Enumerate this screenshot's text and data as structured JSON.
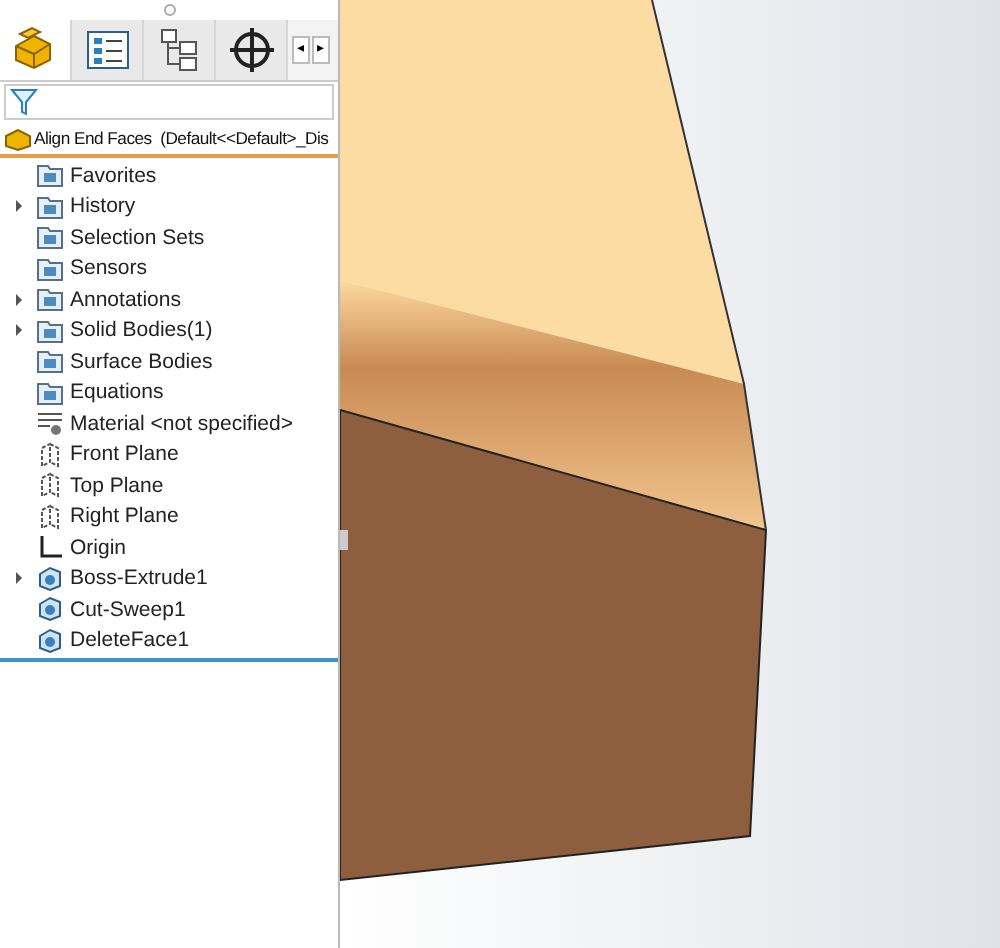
{
  "tabs": [
    {
      "selected": true
    },
    {
      "selected": false
    },
    {
      "selected": false
    },
    {
      "selected": false
    }
  ],
  "tab_scroll": [
    "◂",
    "▸"
  ],
  "part_title": "Align End Faces  (Default<<Default>_Dis",
  "tree": [
    {
      "label": "Favorites",
      "kind": "folder",
      "expander": false
    },
    {
      "label": "History",
      "kind": "folder",
      "expander": true
    },
    {
      "label": "Selection Sets",
      "kind": "folder",
      "expander": false
    },
    {
      "label": "Sensors",
      "kind": "folder",
      "expander": false
    },
    {
      "label": "Annotations",
      "kind": "folder",
      "expander": true
    },
    {
      "label": "Solid Bodies(1)",
      "kind": "folder",
      "expander": true
    },
    {
      "label": "Surface Bodies",
      "kind": "folder",
      "expander": false
    },
    {
      "label": "Equations",
      "kind": "folder",
      "expander": false
    },
    {
      "label": "Material <not specified>",
      "kind": "material",
      "expander": false
    },
    {
      "label": "Front Plane",
      "kind": "plane",
      "expander": false
    },
    {
      "label": "Top Plane",
      "kind": "plane",
      "expander": false
    },
    {
      "label": "Right Plane",
      "kind": "plane",
      "expander": false
    },
    {
      "label": "Origin",
      "kind": "origin",
      "expander": false
    },
    {
      "label": "Boss-Extrude1",
      "kind": "feature",
      "expander": true
    },
    {
      "label": "Cut-Sweep1",
      "kind": "feature",
      "expander": false
    },
    {
      "label": "DeleteFace1",
      "kind": "feature",
      "expander": false
    }
  ]
}
